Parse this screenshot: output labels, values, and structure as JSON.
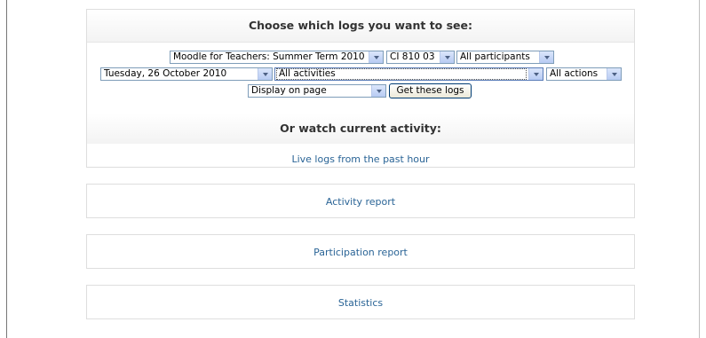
{
  "logs": {
    "heading": "Choose which logs you want to see:",
    "course_select": "Moodle for Teachers: Summer Term 2010",
    "group_select": "CI 810 03",
    "participants_select": "All participants",
    "date_select": "Tuesday, 26 October 2010",
    "activities_select": "All activities",
    "actions_select": "All actions",
    "display_select": "Display on page",
    "get_logs_button": "Get these logs",
    "watch_heading": "Or watch current activity:",
    "live_logs_link": "Live logs from the past hour"
  },
  "links": {
    "activity_report": "Activity report",
    "participation_report": "Participation report",
    "statistics": "Statistics"
  },
  "colors": {
    "link": "#2a6496",
    "select_border": "#7f9db9",
    "box_border": "#dedede"
  }
}
